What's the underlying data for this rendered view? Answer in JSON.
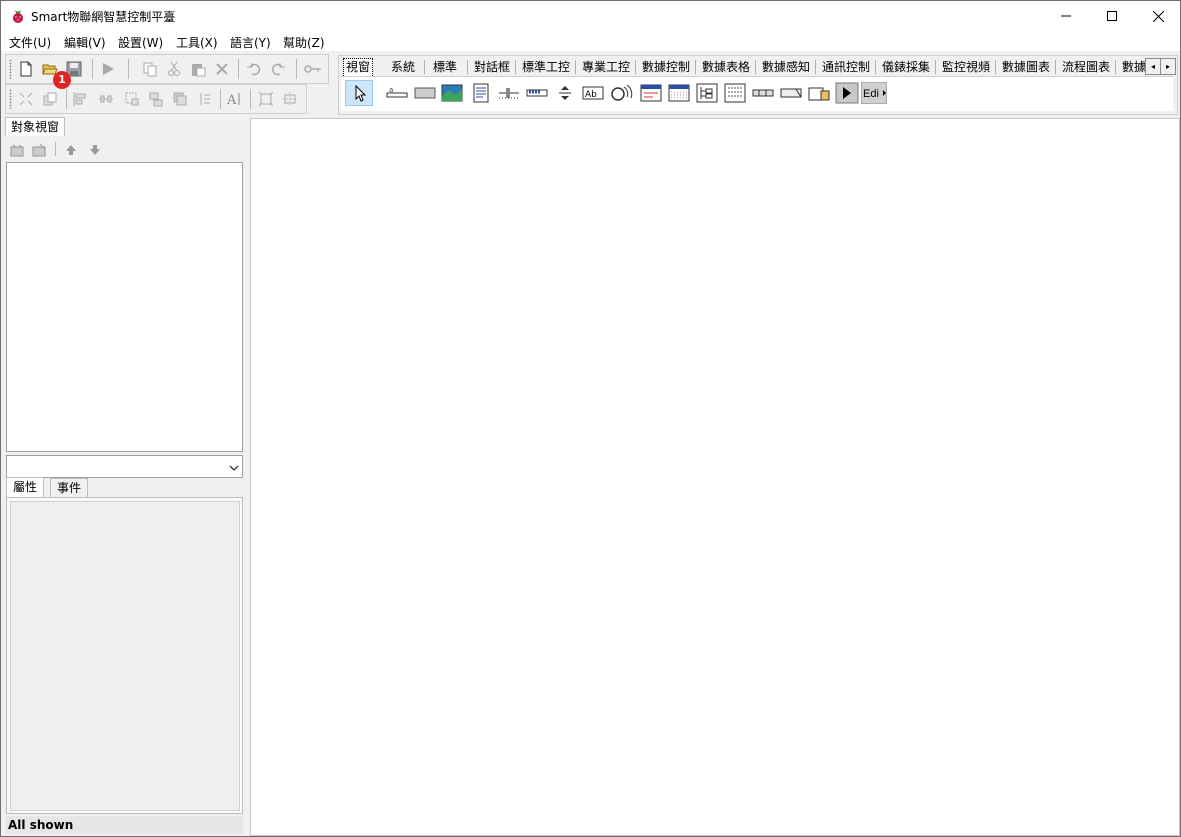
{
  "window": {
    "title": "Smart物聯網智慧控制平臺"
  },
  "menu": [
    {
      "label": "文件(U)"
    },
    {
      "label": "編輯(V)"
    },
    {
      "label": "設置(W)"
    },
    {
      "label": "工具(X)"
    },
    {
      "label": "語言(Y)"
    },
    {
      "label": "幫助(Z)"
    }
  ],
  "badge": {
    "text": "1"
  },
  "palette": {
    "tabs": [
      {
        "label": "視窗",
        "active": true
      },
      {
        "label": "系統"
      },
      {
        "label": "標準"
      },
      {
        "label": "對話框"
      },
      {
        "label": "標準工控"
      },
      {
        "label": "專業工控"
      },
      {
        "label": "數據控制"
      },
      {
        "label": "數據表格"
      },
      {
        "label": "數據感知"
      },
      {
        "label": "通訊控制"
      },
      {
        "label": "儀錶採集"
      },
      {
        "label": "監控視頻"
      },
      {
        "label": "數據圖表"
      },
      {
        "label": "流程圖表"
      },
      {
        "label": "數據"
      }
    ],
    "scroll_left": "◂",
    "scroll_right": "▸",
    "edit_component_label": "Edi"
  },
  "left_panel": {
    "object_tab": "對象視窗",
    "property_tabs": [
      {
        "label": "屬性",
        "active": true
      },
      {
        "label": "事件"
      }
    ],
    "status": "All shown"
  }
}
